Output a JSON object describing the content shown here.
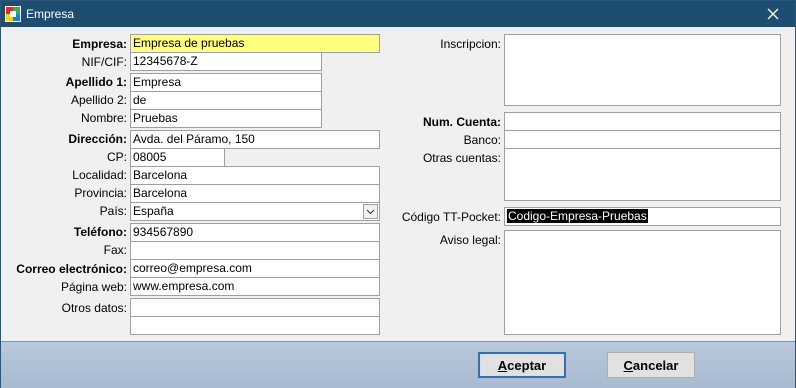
{
  "window": {
    "title": "Empresa",
    "close_glyph": "✕"
  },
  "left": {
    "empresa": {
      "label": "Empresa:",
      "value": "Empresa de pruebas"
    },
    "nif": {
      "label": "NIF/CIF:",
      "value": "12345678-Z"
    },
    "apellido1": {
      "label": "Apellido 1:",
      "value": "Empresa"
    },
    "apellido2": {
      "label": "Apellido 2:",
      "value": "de"
    },
    "nombre": {
      "label": "Nombre:",
      "value": "Pruebas"
    },
    "direccion": {
      "label": "Dirección:",
      "value": "Avda. del Páramo, 150"
    },
    "cp": {
      "label": "CP:",
      "value": "08005"
    },
    "localidad": {
      "label": "Localidad:",
      "value": "Barcelona"
    },
    "provincia": {
      "label": "Provincia:",
      "value": "Barcelona"
    },
    "pais": {
      "label": "País:",
      "value": "España"
    },
    "telefono": {
      "label": "Teléfono:",
      "value": "934567890"
    },
    "fax": {
      "label": "Fax:",
      "value": ""
    },
    "correo": {
      "label": "Correo electrónico:",
      "value": "correo@empresa.com"
    },
    "web": {
      "label": "Página web:",
      "value": "www.empresa.com"
    },
    "otros": {
      "label": "Otros datos:",
      "line1": "",
      "line2": ""
    }
  },
  "right": {
    "inscripcion": {
      "label": "Inscripcion:"
    },
    "num_cuenta": {
      "label": "Num. Cuenta:",
      "value": ""
    },
    "banco": {
      "label": "Banco:",
      "value": ""
    },
    "otras_cuentas": {
      "label": "Otras cuentas:"
    },
    "tt_pocket": {
      "label": "Código TT-Pocket:",
      "value": "Codigo-Empresa-Pruebas"
    },
    "aviso_legal": {
      "label": "Aviso legal:"
    }
  },
  "buttons": {
    "aceptar": {
      "mnemonic": "A",
      "rest": "ceptar"
    },
    "cancelar": {
      "mnemonic": "C",
      "rest": "ancelar"
    }
  },
  "colors": {
    "titlebar": "#1e4d72",
    "required_field": "#ffff80",
    "footer": "#aebfd4"
  },
  "icons": [
    "app-icon",
    "close-icon",
    "chevron-down-icon"
  ]
}
